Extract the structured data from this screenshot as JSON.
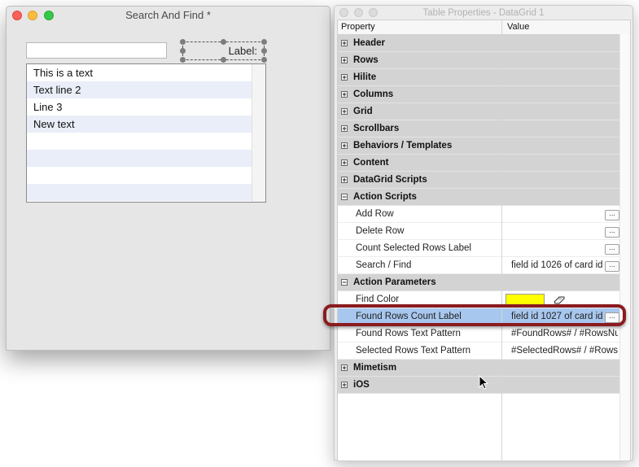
{
  "left_window": {
    "title": "Search And Find *",
    "search_value": "",
    "label_text": "Label:",
    "list_rows": [
      "This is a text",
      "Text line 2",
      "Line 3",
      "New text",
      "",
      "",
      "",
      ""
    ]
  },
  "right_window": {
    "title": "Table Properties - DataGrid 1",
    "columns": {
      "property": "Property",
      "value": "Value"
    },
    "rows": [
      {
        "type": "section",
        "expanded": false,
        "label": "Header",
        "value": ""
      },
      {
        "type": "section",
        "expanded": false,
        "label": "Rows",
        "value": ""
      },
      {
        "type": "section",
        "expanded": false,
        "label": "Hilite",
        "value": ""
      },
      {
        "type": "section",
        "expanded": false,
        "label": "Columns",
        "value": ""
      },
      {
        "type": "section",
        "expanded": false,
        "label": "Grid",
        "value": ""
      },
      {
        "type": "section",
        "expanded": false,
        "label": "Scrollbars",
        "value": ""
      },
      {
        "type": "section",
        "expanded": false,
        "label": "Behaviors / Templates",
        "value": ""
      },
      {
        "type": "section",
        "expanded": false,
        "label": "Content",
        "value": ""
      },
      {
        "type": "section",
        "expanded": false,
        "label": "DataGrid Scripts",
        "value": ""
      },
      {
        "type": "section",
        "expanded": true,
        "label": "Action Scripts",
        "value": ""
      },
      {
        "type": "item",
        "label": "Add Row",
        "value": "",
        "button": "..."
      },
      {
        "type": "item",
        "label": "Delete Row",
        "value": "",
        "button": "..."
      },
      {
        "type": "item",
        "label": "Count Selected Rows Label",
        "value": "",
        "button": "..."
      },
      {
        "type": "item",
        "label": "Search / Find",
        "value": "field id 1026 of card id",
        "button": "..."
      },
      {
        "type": "section",
        "expanded": true,
        "label": "Action Parameters",
        "value": ""
      },
      {
        "type": "color",
        "label": "Find Color",
        "value": "",
        "color": "#ffff00",
        "icon": "eraser-icon"
      },
      {
        "type": "item",
        "selected": true,
        "label": "Found Rows Count Label",
        "value": "field id 1027 of card id",
        "button": "..."
      },
      {
        "type": "item",
        "label": "Found Rows Text Pattern",
        "value": "#FoundRows# / #RowsNumber#"
      },
      {
        "type": "item",
        "label": "Selected Rows Text Pattern",
        "value": "#SelectedRows# / #Rows"
      },
      {
        "type": "section",
        "expanded": false,
        "label": "Mimetism",
        "value": ""
      },
      {
        "type": "section",
        "expanded": false,
        "label": "iOS",
        "value": ""
      }
    ]
  },
  "colors": {
    "highlight_ring": "#8a1b1f",
    "selected_row": "#a8c7ee",
    "section_row": "#d3d3d3",
    "find_color": "#ffff00"
  }
}
